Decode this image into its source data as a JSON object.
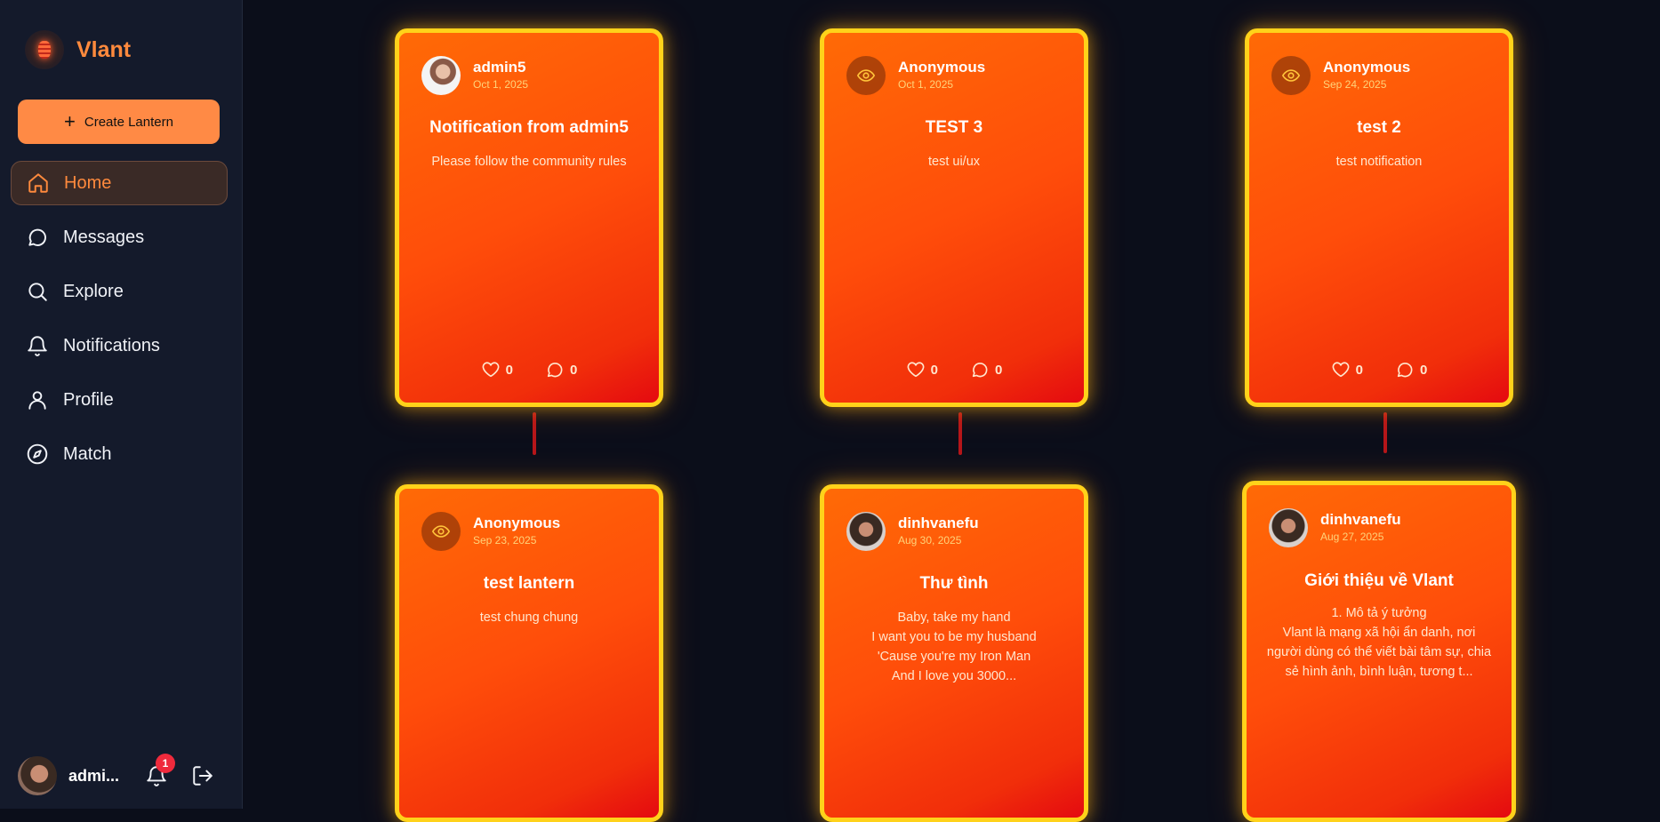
{
  "app": {
    "name": "Vlant"
  },
  "sidebar": {
    "create_label": "Create Lantern",
    "items": [
      {
        "label": "Home",
        "icon": "home-icon",
        "active": true
      },
      {
        "label": "Messages",
        "icon": "message-circle-icon",
        "active": false
      },
      {
        "label": "Explore",
        "icon": "search-icon",
        "active": false
      },
      {
        "label": "Notifications",
        "icon": "bell-icon",
        "active": false
      },
      {
        "label": "Profile",
        "icon": "user-icon",
        "active": false
      },
      {
        "label": "Match",
        "icon": "compass-icon",
        "active": false
      }
    ],
    "user": {
      "name": "admi...",
      "notification_count": "1"
    }
  },
  "colors": {
    "accent": "#ff8a3d",
    "card_border": "#ffd21a",
    "card_gradient_start": "#ff6a06",
    "card_gradient_end": "#e40a10",
    "background": "#0b0e1a",
    "sidebar": "#141a2b",
    "badge": "#ef2a3c"
  },
  "lanterns": [
    {
      "author": "admin5",
      "avatar": "photo",
      "date": "Oct 1, 2025",
      "title": "Notification from admin5",
      "body": "Please follow the community rules",
      "likes": "0",
      "comments": "0"
    },
    {
      "author": "Anonymous",
      "avatar": "eye-icon",
      "date": "Oct 1, 2025",
      "title": "TEST 3",
      "body": "test ui/ux",
      "likes": "0",
      "comments": "0"
    },
    {
      "author": "Anonymous",
      "avatar": "eye-icon",
      "date": "Sep 24, 2025",
      "title": "test 2",
      "body": "test notification",
      "likes": "0",
      "comments": "0"
    },
    {
      "author": "Anonymous",
      "avatar": "eye-icon",
      "date": "Sep 23, 2025",
      "title": "test lantern",
      "body": "test chung chung"
    },
    {
      "author": "dinhvanefu",
      "avatar": "photo",
      "date": "Aug 30, 2025",
      "title": "Thư tình",
      "body": "Baby, take my hand\nI want you to be my husband\n'Cause you're my Iron Man\nAnd I love you 3000..."
    },
    {
      "author": "dinhvanefu",
      "avatar": "photo",
      "date": "Aug 27, 2025",
      "title": "Giới thiệu về Vlant",
      "body": "1. Mô tả ý tưởng\nVlant là mạng xã hội ẩn danh, nơi người dùng có thể viết bài tâm sự, chia sẻ hình ảnh, bình luận, tương t..."
    }
  ]
}
